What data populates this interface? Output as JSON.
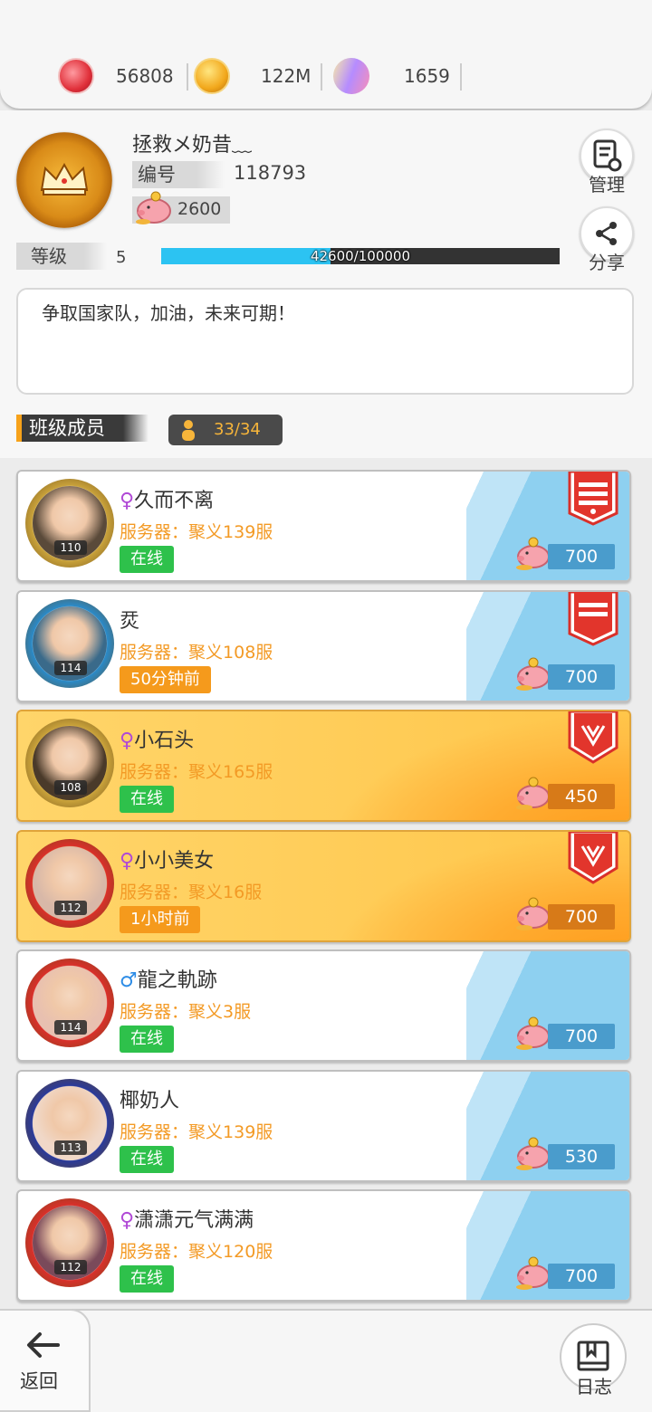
{
  "currencies": [
    {
      "icon": "red-token-icon",
      "value": "56808"
    },
    {
      "icon": "gold-coin-icon",
      "value": "122M"
    },
    {
      "icon": "gem-pacifier-icon",
      "value": "1659"
    }
  ],
  "profile": {
    "name": "拯救メ奶昔﹏",
    "id_label": "编号",
    "id_value": "118793",
    "pig_value": "2600",
    "level_label": "等级",
    "level_value": "5",
    "xp_text": "42600/100000",
    "xp_fraction": 0.426,
    "motto": "争取国家队，加油，未来可期！",
    "manage_label": "管理",
    "share_label": "分享"
  },
  "members_section": {
    "title": "班级成员",
    "count": "33/34"
  },
  "server_prefix": "服务器：",
  "members": [
    {
      "sex": "♀",
      "sex_class": "f",
      "name": "久而不离",
      "server": "聚义139服",
      "status": "在线",
      "status_type": "online",
      "level": "110",
      "pig": "700",
      "card": "white",
      "banner": "red-flag-star"
    },
    {
      "sex": "",
      "sex_class": "",
      "name": "烎",
      "server": "聚义108服",
      "status": "50分钟前",
      "status_type": "away",
      "level": "114",
      "pig": "700",
      "card": "white",
      "banner": "red-flag"
    },
    {
      "sex": "♀",
      "sex_class": "f",
      "name": "小石头",
      "server": "聚义165服",
      "status": "在线",
      "status_type": "online",
      "level": "108",
      "pig": "450",
      "card": "gold",
      "banner": "red-shield"
    },
    {
      "sex": "♀",
      "sex_class": "f",
      "name": "小小美女",
      "server": "聚义16服",
      "status": "1小时前",
      "status_type": "away",
      "level": "112",
      "pig": "700",
      "card": "gold",
      "banner": "red-shield"
    },
    {
      "sex": "♂",
      "sex_class": "m",
      "name": "龍之軌跡",
      "server": "聚义3服",
      "status": "在线",
      "status_type": "online",
      "level": "114",
      "pig": "700",
      "card": "white",
      "banner": ""
    },
    {
      "sex": "",
      "sex_class": "",
      "name": "椰奶人",
      "server": "聚义139服",
      "status": "在线",
      "status_type": "online",
      "level": "113",
      "pig": "530",
      "card": "white",
      "banner": ""
    },
    {
      "sex": "♀",
      "sex_class": "f",
      "name": "潇潇元气满满",
      "server": "聚义120服",
      "status": "在线",
      "status_type": "online",
      "level": "112",
      "pig": "700",
      "card": "white",
      "banner": ""
    }
  ],
  "bottom": {
    "back_label": "返回",
    "log_label": "日志"
  },
  "colors": {
    "online": "#2ec14b",
    "away": "#f59a1c",
    "server_text": "#f39a25",
    "xp_fill": "#2cc3f2",
    "pig_bar_white": "#4a9ccc",
    "pig_bar_gold": "#d77a18"
  }
}
